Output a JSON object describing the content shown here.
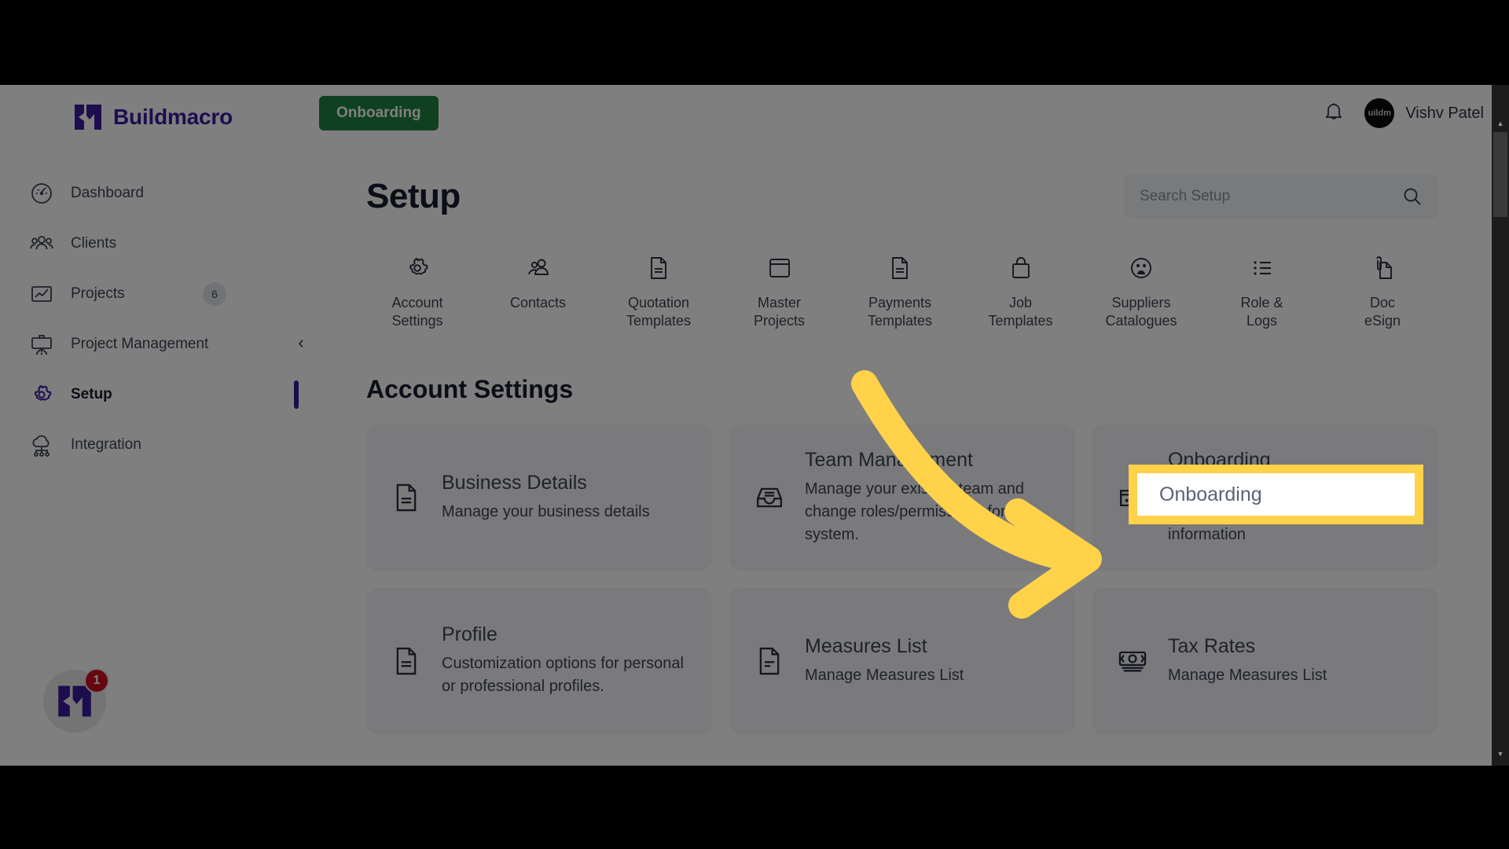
{
  "brand": {
    "name": "Buildmacro"
  },
  "sidebar": {
    "collapse_icon": "chevron-left-icon",
    "items": [
      {
        "label": "Dashboard",
        "icon": "speedometer-icon",
        "badge": "",
        "active": false
      },
      {
        "label": "Clients",
        "icon": "people-icon",
        "badge": "",
        "active": false
      },
      {
        "label": "Projects",
        "icon": "chart-box-icon",
        "badge": "6",
        "active": false
      },
      {
        "label": "Project Management",
        "icon": "easel-icon",
        "badge": "",
        "active": false
      },
      {
        "label": "Setup",
        "icon": "gear-icon",
        "badge": "",
        "active": true
      },
      {
        "label": "Integration",
        "icon": "cloud-nodes-icon",
        "badge": "",
        "active": false
      }
    ],
    "fab": {
      "icon": "buildmacro-logo-icon",
      "count": "1"
    }
  },
  "topbar": {
    "onboarding_label": "Onboarding",
    "bell_icon": "bell-icon",
    "avatar_text": "uildm",
    "user_name": "Vishv Patel"
  },
  "main": {
    "title": "Setup",
    "search": {
      "placeholder": "Search Setup",
      "value": "",
      "icon": "search-icon"
    },
    "categories": [
      {
        "label": "Account\nSettings",
        "icon": "gear-icon"
      },
      {
        "label": "Contacts",
        "icon": "contacts-icon"
      },
      {
        "label": "Quotation\nTemplates",
        "icon": "document-icon"
      },
      {
        "label": "Master\nProjects",
        "icon": "window-icon"
      },
      {
        "label": "Payments\nTemplates",
        "icon": "document-icon"
      },
      {
        "label": "Job\nTemplates",
        "icon": "bag-icon"
      },
      {
        "label": "Suppliers\nCatalogues",
        "icon": "supplier-icon"
      },
      {
        "label": "Role &\nLogs",
        "icon": "list-icon"
      },
      {
        "label": "Doc\neSign",
        "icon": "doc-sign-icon"
      }
    ],
    "section_title": "Account Settings",
    "cards": [
      {
        "title": "Business Details",
        "desc": "Manage your business details",
        "icon": "document-icon"
      },
      {
        "title": "Team Management",
        "desc": "Manage your existing team and change roles/permissions for this system.",
        "icon": "inbox-icon"
      },
      {
        "title": "Onboarding",
        "desc": "Manage your onboarding plan, payment method and billing information",
        "icon": "card-icon"
      },
      {
        "title": "Profile",
        "desc": "Customization options for personal or professional profiles.",
        "icon": "document-icon"
      },
      {
        "title": "Measures List",
        "desc": "Manage Measures List",
        "icon": "document-icon"
      },
      {
        "title": "Tax Rates",
        "desc": "Manage Measures List",
        "icon": "money-icon"
      }
    ]
  },
  "annotation": {
    "highlight_label": "Onboarding",
    "arrow_color": "#FFD24A",
    "highlight_border_color": "#FFD24A"
  },
  "colors": {
    "brand_purple": "#3A1A9E",
    "accent_green": "#1E8040",
    "badge_red": "#CF1020",
    "text_dark": "#161B2E",
    "text_muted": "#3D4455",
    "card_bg": "#F4F5F8"
  },
  "scrollbar": {
    "icon_up": "caret-up-icon",
    "icon_down": "caret-down-icon"
  }
}
